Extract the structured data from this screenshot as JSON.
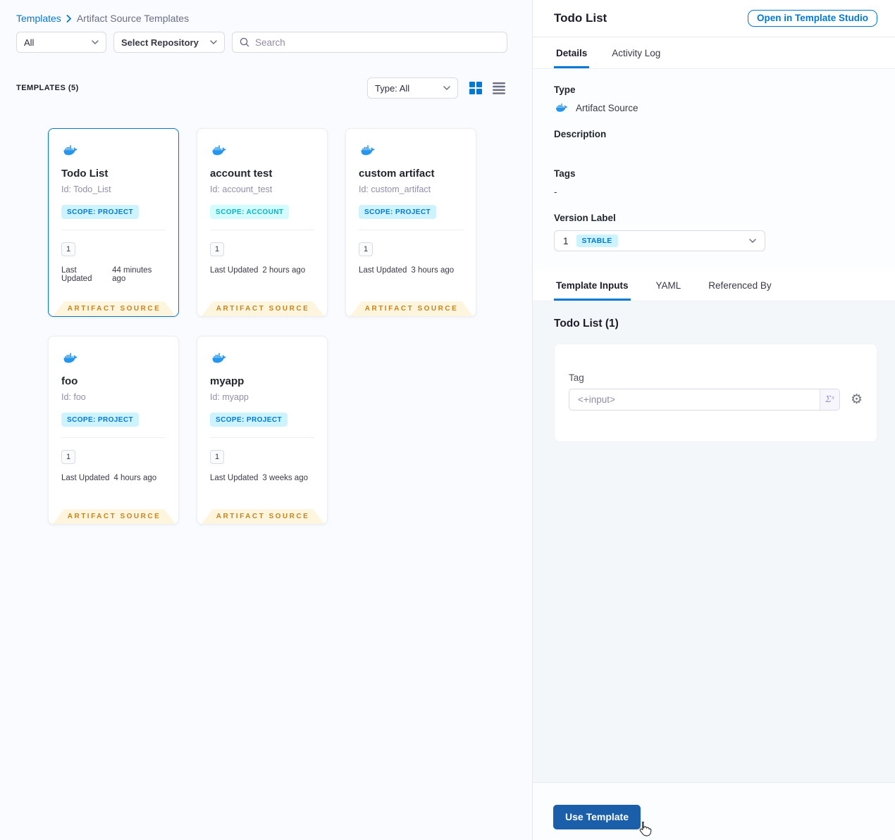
{
  "breadcrumb": {
    "root": "Templates",
    "current": "Artifact Source Templates"
  },
  "filters": {
    "scope_select": "All",
    "repository_select": "Select Repository",
    "search_placeholder": "Search"
  },
  "list_header": {
    "count_label": "TEMPLATES (5)",
    "type_select": "Type: All"
  },
  "card_labels": {
    "last_updated": "Last Updated",
    "footer": "ARTIFACT SOURCE"
  },
  "cards": [
    {
      "name": "Todo List",
      "id": "Id: Todo_List",
      "scope": "SCOPE: PROJECT",
      "scope_type": "project",
      "version": "1",
      "last_updated": "44 minutes ago"
    },
    {
      "name": "account test",
      "id": "Id: account_test",
      "scope": "SCOPE: ACCOUNT",
      "scope_type": "account",
      "version": "1",
      "last_updated": "2 hours ago"
    },
    {
      "name": "custom artifact",
      "id": "Id: custom_artifact",
      "scope": "SCOPE: PROJECT",
      "scope_type": "project",
      "version": "1",
      "last_updated": "3 hours ago"
    },
    {
      "name": "foo",
      "id": "Id: foo",
      "scope": "SCOPE: PROJECT",
      "scope_type": "project",
      "version": "1",
      "last_updated": "4 hours ago"
    },
    {
      "name": "myapp",
      "id": "Id: myapp",
      "scope": "SCOPE: PROJECT",
      "scope_type": "project",
      "version": "1",
      "last_updated": "3 weeks ago"
    }
  ],
  "panel": {
    "title": "Todo List",
    "open_in_studio_button": "Open in Template Studio",
    "tabs": {
      "details": "Details",
      "activity_log": "Activity Log"
    },
    "details": {
      "type_label": "Type",
      "type_value": "Artifact Source",
      "description_label": "Description",
      "tags_label": "Tags",
      "tags_value": "-",
      "version_label": "Version Label",
      "version_value": "1",
      "version_badge": "STABLE"
    },
    "inner_tabs": {
      "template_inputs": "Template Inputs",
      "yaml": "YAML",
      "referenced_by": "Referenced By"
    },
    "inputs_heading": "Todo List (1)",
    "tag_field": {
      "label": "Tag",
      "value": "<+input>",
      "expression_icon": "Σˣ"
    },
    "use_template_button": "Use Template"
  },
  "icons": {
    "gear": "⚙"
  },
  "colors": {
    "accent_blue": "#0278d5",
    "docker_blue": "#2496ed",
    "scope_project_bg": "#cdf4fe",
    "scope_project_text": "#0278d5",
    "scope_account_bg": "#d3fcfe",
    "scope_account_text": "#0ab4c3",
    "artifact_footer_bg": "#fdf5dd",
    "artifact_footer_text": "#c8831c",
    "use_template_bg": "#1b5eaa"
  }
}
